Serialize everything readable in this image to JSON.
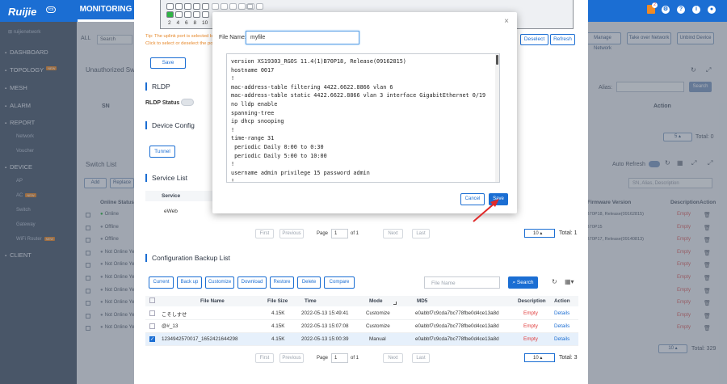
{
  "header": {
    "brand": "Ruijie",
    "cloud_badge": "rcs",
    "nav_tab": "MONITORING",
    "notification_count": "2"
  },
  "sidebar": {
    "account": "ruijienetwork",
    "items": [
      {
        "label": "DASHBOARD"
      },
      {
        "label": "TOPOLOGY",
        "badge": "NEW"
      },
      {
        "label": "MESH"
      },
      {
        "label": "ALARM"
      },
      {
        "label": "REPORT"
      },
      {
        "label": "Network",
        "sub": true
      },
      {
        "label": "Voucher",
        "sub": true
      },
      {
        "label": "DEVICE"
      },
      {
        "label": "AP",
        "sub": true
      },
      {
        "label": "AC",
        "sub": true,
        "badge": "NEW"
      },
      {
        "label": "Switch",
        "sub": true
      },
      {
        "label": "Gateway",
        "sub": true
      },
      {
        "label": "WiFi Router",
        "sub": true,
        "badge": "NEW"
      },
      {
        "label": "CLIENT"
      }
    ]
  },
  "background": {
    "filter_all": "ALL",
    "search_label": "Search",
    "manage_network": "Manage Network",
    "take_over_network": "Take over Network",
    "unbind_device": "Unbind Device",
    "unauthorized_title": "Unauthorized Switch",
    "sn_header": "SN",
    "alias_label": "Alias:",
    "search_button": "Search",
    "action_header": "Action",
    "page_size_1": "5",
    "total_1": "Total: 0",
    "switch_list_title": "Switch List",
    "auto_refresh": "Auto Refresh",
    "add_button": "Add",
    "replace_button": "Replace",
    "sn_alias_placeholder": "SN, Alias, Description",
    "online_status_header": "Online Status",
    "firmware_header": "Firmware Version",
    "description_header": "Description",
    "action_header_2": "Action",
    "rows": [
      {
        "status": "Online",
        "firmware": "B70P18, Release(09162815)",
        "desc": "Empty"
      },
      {
        "status": "Offline",
        "firmware": "B70P15",
        "desc": "Empty"
      },
      {
        "status": "Offline",
        "firmware": "B70P17, Release(09140813)",
        "desc": "Empty"
      },
      {
        "status": "Not Online Yet",
        "firmware": "",
        "desc": "Empty"
      },
      {
        "status": "Not Online Yet",
        "firmware": "",
        "desc": "Empty"
      },
      {
        "status": "Not Online Yet",
        "firmware": "",
        "desc": "Empty"
      },
      {
        "status": "Not Online Yet",
        "firmware": "",
        "desc": "Empty"
      },
      {
        "status": "Not Online Yet",
        "firmware": "",
        "desc": "Empty"
      },
      {
        "status": "Not Online Yet",
        "firmware": "",
        "desc": "Empty"
      },
      {
        "status": "Not Online Yet",
        "firmware": "",
        "desc": "Empty"
      }
    ],
    "page_size_2": "10",
    "total_2": "Total: 329"
  },
  "panel": {
    "port_numbers": [
      "2",
      "4",
      "6",
      "8",
      "10"
    ],
    "tip_line1": "Tip: The uplink port is selected by",
    "tip_line2": "Click to select or deselect the por",
    "deselect": "Deselect",
    "refresh": "Refresh",
    "save": "Save",
    "rldp_title": "RLDP",
    "rldp_status": "RLDP Status",
    "device_config_title": "Device Config",
    "tunnel": "Tunnel",
    "service_list_title": "Service List",
    "service_header": "Service",
    "service_row": "eWeb",
    "service_pager": {
      "first": "First",
      "previous": "Previous",
      "page": "Page",
      "page_value": "1",
      "of": "of 1",
      "next": "Next",
      "last": "Last",
      "size": "10",
      "total": "Total: 1"
    },
    "backup_title": "Configuration Backup List",
    "backup_buttons": [
      "Current",
      "Back up",
      "Customize",
      "Download",
      "Restore",
      "Delete",
      "Compare"
    ],
    "file_name_placeholder": "File Name",
    "search": "Search",
    "columns": [
      "File Name",
      "File Size",
      "Time",
      "Mode",
      "MD5",
      "Description",
      "Action"
    ],
    "backups": [
      {
        "checked": false,
        "name": "こそしすせ",
        "size": "4.15K",
        "time": "2022-05-13 15:49:41",
        "mode": "Customize",
        "md5": "e0abbf7c9cda7bc778fbe0d4ce13a8d",
        "desc": "Empty",
        "action": "Details"
      },
      {
        "checked": false,
        "name": "@#_13",
        "size": "4.15K",
        "time": "2022-05-13 15:07:08",
        "mode": "Customize",
        "md5": "e0abbf7c9cda7bc778fbe0d4ce13a8d",
        "desc": "Empty",
        "action": "Details"
      },
      {
        "checked": true,
        "name": "1234942570017_1652421644298",
        "size": "4.15K",
        "time": "2022-05-13 15:00:39",
        "mode": "Manual",
        "md5": "e0abbf7c9cda7bc778fbe0d4ce13a8d",
        "desc": "Empty",
        "action": "Details"
      }
    ],
    "backup_pager": {
      "first": "First",
      "previous": "Previous",
      "page": "Page",
      "page_value": "1",
      "of": "of 1",
      "next": "Next",
      "last": "Last",
      "size": "10",
      "total": "Total: 3"
    }
  },
  "dialog": {
    "close": "×",
    "file_name_label": "File Name:",
    "file_name_value": "myfile",
    "config_lines": [
      "version XS19303_RGOS 11.4(1)B70P18, Release(09162815)",
      "hostname 0017",
      "!",
      "mac-address-table filtering 4422.6622.8866 vlan 6",
      "mac-address-table static 4422.6622.8866 vlan 3 interface GigabitEthernet 0/19",
      "no lldp enable",
      "spanning-tree",
      "ip dhcp snooping",
      "!",
      "time-range 31",
      " periodic Daily 0:00 to 0:30",
      " periodic Daily 5:00 to 10:00",
      "!",
      "username admin privilege 15 password admin",
      "!"
    ],
    "cancel": "Cancel",
    "save": "Save"
  },
  "colors": {
    "primary": "#1b6ed3",
    "sidebar": "#4b5b70",
    "empty_red": "#e03c3c",
    "port_green": "#2fb344"
  }
}
